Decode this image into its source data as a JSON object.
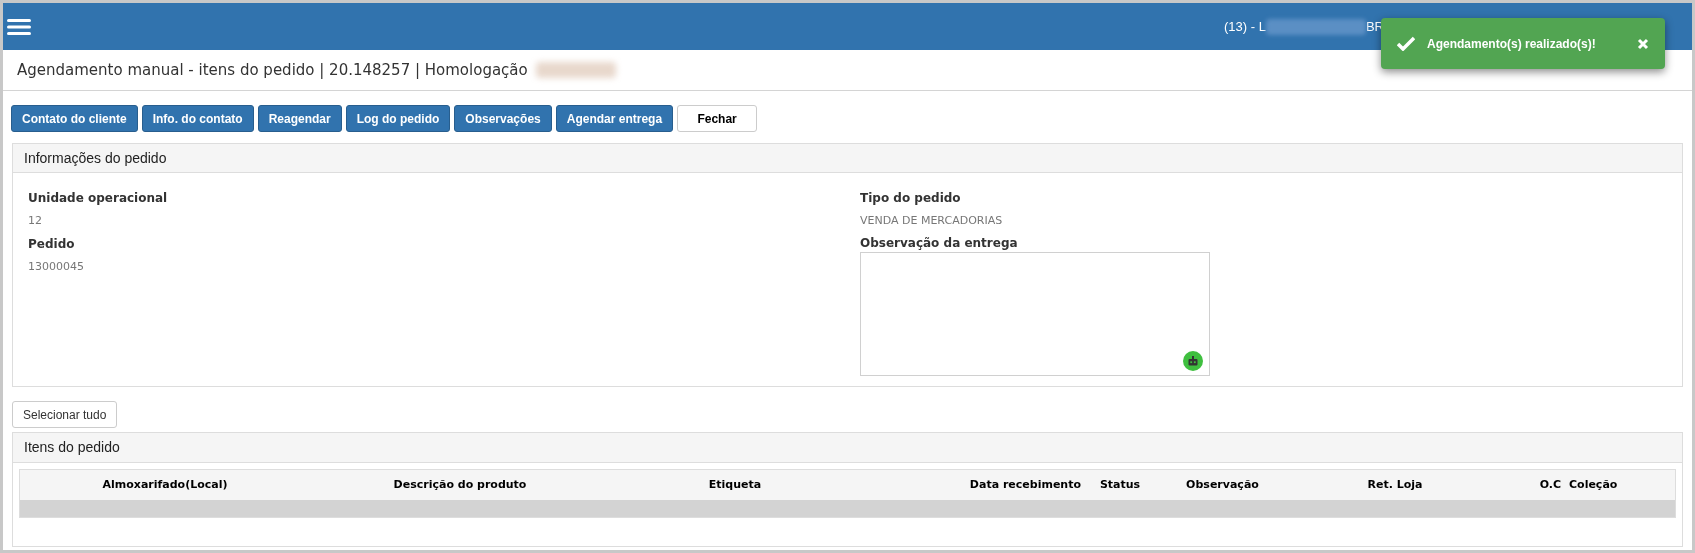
{
  "header": {
    "user_prefix": "(13) - L",
    "user_suffix": "BR"
  },
  "toast": {
    "message": "Agendamento(s) realizado(s)!"
  },
  "page_title": "Agendamento manual - itens do pedido | 20.148257 | Homologação",
  "actions": [
    {
      "label": "Contato do cliente",
      "kind": "primary"
    },
    {
      "label": "Info. do contato",
      "kind": "primary"
    },
    {
      "label": "Reagendar",
      "kind": "primary"
    },
    {
      "label": "Log do pedido",
      "kind": "primary"
    },
    {
      "label": "Observações",
      "kind": "primary"
    },
    {
      "label": "Agendar entrega",
      "kind": "primary"
    },
    {
      "label": "Fechar",
      "kind": "default"
    }
  ],
  "order_info": {
    "title": "Informações do pedido",
    "left": [
      {
        "label": "Unidade operacional",
        "value": "12"
      },
      {
        "label": "Pedido",
        "value": "13000045"
      }
    ],
    "right": [
      {
        "label": "Tipo do pedido",
        "value": "VENDA DE MERCADORIAS"
      }
    ],
    "note_label": "Observação da entrega"
  },
  "select_all": "Selecionar tudo",
  "items": {
    "title": "Itens do pedido",
    "columns": [
      "Almoxarifado(Local)",
      "Descrição do produto",
      "Etiqueta",
      "Data recebimento",
      "Status",
      "Observação",
      "Ret. Loja",
      "O.C",
      "Coleção"
    ]
  }
}
